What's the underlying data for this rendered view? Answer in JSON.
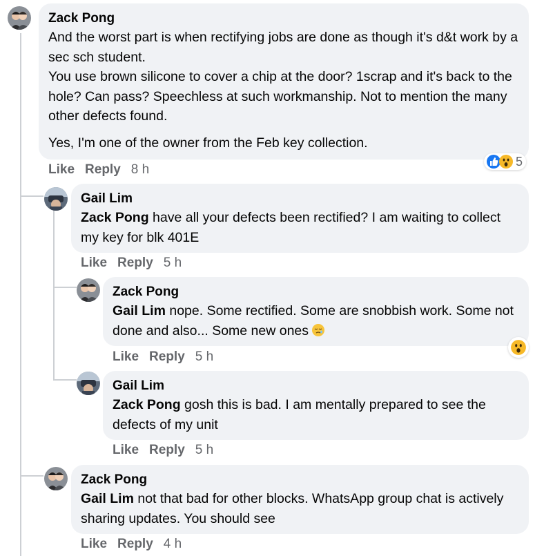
{
  "comments": [
    {
      "author": "Zack Pong",
      "mention": "",
      "text": "And the worst part is when rectifying jobs are done as though it's d&t work by a sec sch student.",
      "text_line2": "You use brown silicone to cover a chip at the door? 1scrap and it's back to the hole? Can pass? Speechless at such workmanship. Not to mention the many other defects found.",
      "text_para2": "Yes, I'm one of the owner from the Feb key collection.",
      "like": "Like",
      "reply": "Reply",
      "time": "8 h",
      "reaction_count": "5"
    },
    {
      "author": "Gail Lim",
      "mention": "Zack Pong",
      "text": " have all your defects been rectified? I am waiting to collect my key for blk 401E",
      "like": "Like",
      "reply": "Reply",
      "time": "5 h"
    },
    {
      "author": "Zack Pong",
      "mention": "Gail Lim",
      "text": " nope. Some rectified. Some are snobbish work. Some not done and also... Some new ones",
      "like": "Like",
      "reply": "Reply",
      "time": "5 h"
    },
    {
      "author": "Gail Lim",
      "mention": "Zack Pong",
      "text": " gosh this is bad. I am mentally prepared to see the defects of my unit",
      "like": "Like",
      "reply": "Reply",
      "time": "5 h"
    },
    {
      "author": "Zack Pong",
      "mention": "Gail Lim",
      "text": " not that bad for other blocks. WhatsApp group chat is actively sharing updates. You should see",
      "like": "Like",
      "reply": "Reply",
      "time": "4 h"
    }
  ],
  "colors": {
    "bubble": "#f0f2f5",
    "meta": "#65676b",
    "like_blue": "#1877f2",
    "wow_yellow": "#f7b928"
  },
  "icons": {
    "reaction_like": "like-reaction-icon",
    "reaction_wow": "wow-reaction-icon",
    "inline_emoji": "sleepy-emoji-icon"
  }
}
